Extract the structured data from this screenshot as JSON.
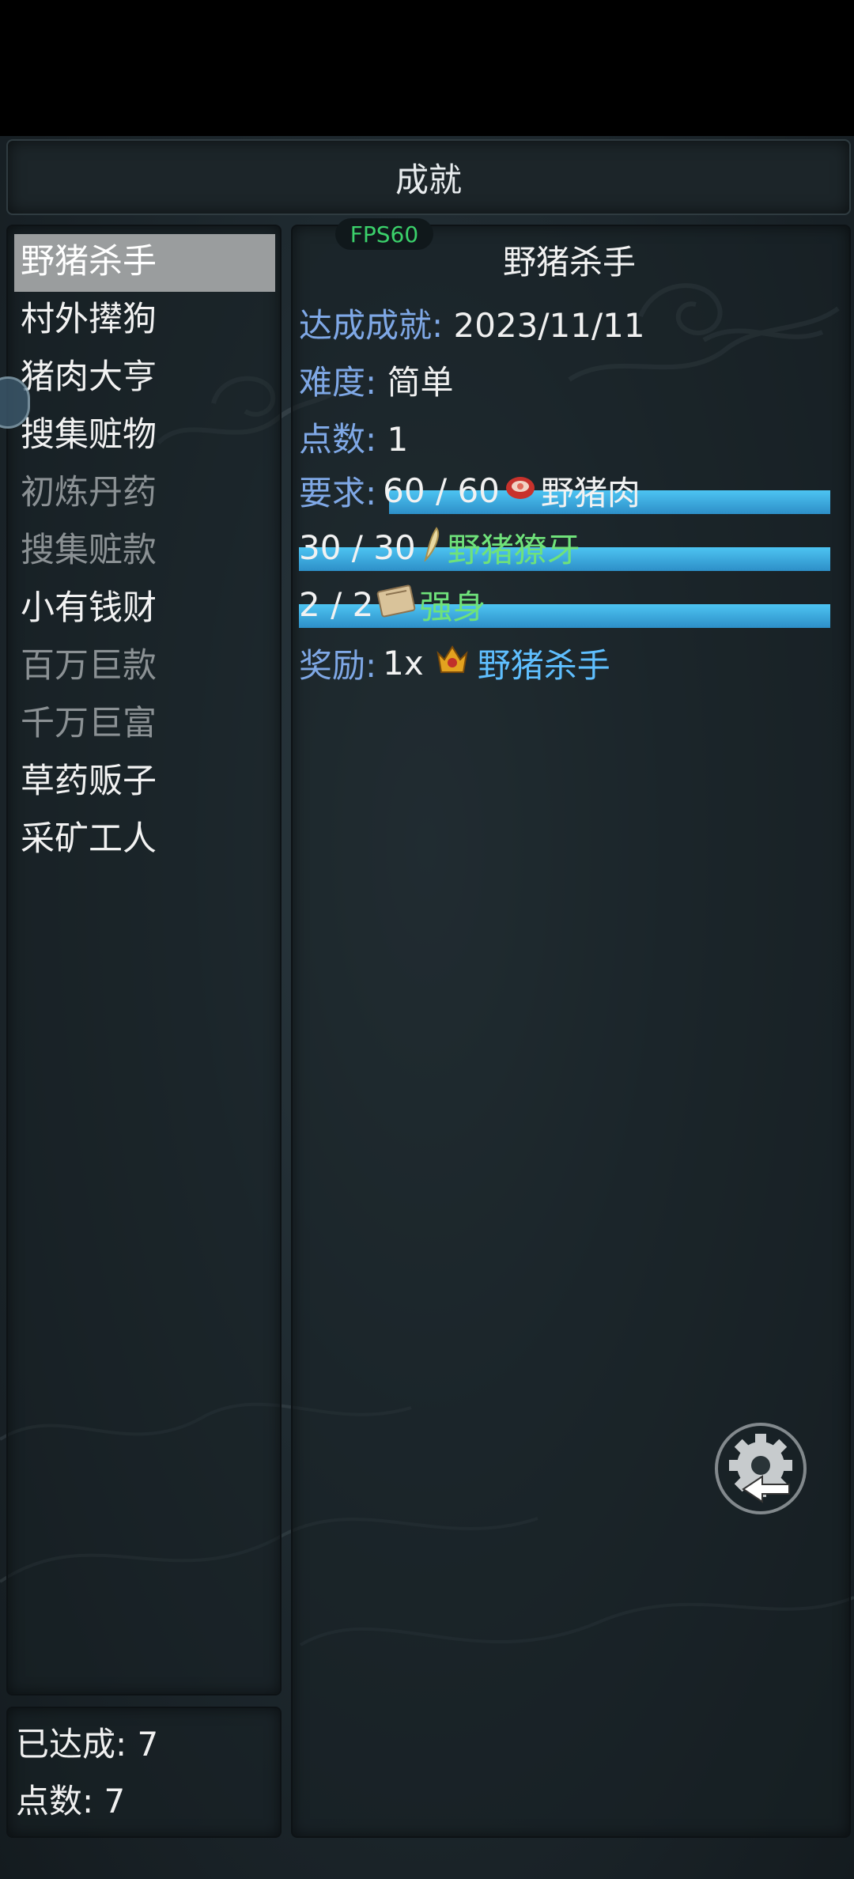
{
  "header": {
    "title": "成就"
  },
  "fps_badge": "FPS60",
  "achievements": [
    {
      "label": "野猪杀手",
      "state": "selected"
    },
    {
      "label": "村外撵狗",
      "state": "achieved"
    },
    {
      "label": "猪肉大亨",
      "state": "achieved"
    },
    {
      "label": "搜集赃物",
      "state": "achieved"
    },
    {
      "label": "初炼丹药",
      "state": "locked"
    },
    {
      "label": "搜集赃款",
      "state": "locked"
    },
    {
      "label": "小有钱财",
      "state": "achieved"
    },
    {
      "label": "百万巨款",
      "state": "locked"
    },
    {
      "label": "千万巨富",
      "state": "locked"
    },
    {
      "label": "草药贩子",
      "state": "achieved"
    },
    {
      "label": "采矿工人",
      "state": "achieved"
    }
  ],
  "summary": {
    "achieved_text": "已达成: 7",
    "points_text": "点数: 7"
  },
  "detail": {
    "title": "野猪杀手",
    "achieved_label": "达成成就:",
    "achieved_value": "2023/11/11",
    "difficulty_label": "难度:",
    "difficulty_value": "简单",
    "points_label": "点数:",
    "points_value": "1",
    "requirements_label": "要求:",
    "requirements": [
      {
        "progress": "60 / 60",
        "item": "野猪肉",
        "icon": "meat-icon",
        "fill": 1.0
      },
      {
        "progress": "30 / 30",
        "item": "野猪獠牙",
        "icon": "tusk-icon",
        "fill": 1.0
      },
      {
        "progress": "2 / 2",
        "item": "强身",
        "icon": "book-icon",
        "fill": 1.0
      }
    ],
    "reward_label": "奖励:",
    "reward_count": "1x",
    "reward_item": "野猪杀手",
    "reward_icon": "crown-badge-icon"
  },
  "settings_icon": "settings-back-icon",
  "colors": {
    "label_blue": "#7fa8e6",
    "item_green": "#6fe27a",
    "reward_blue": "#5fbfff",
    "progress_bar": "#3aa9e0"
  }
}
